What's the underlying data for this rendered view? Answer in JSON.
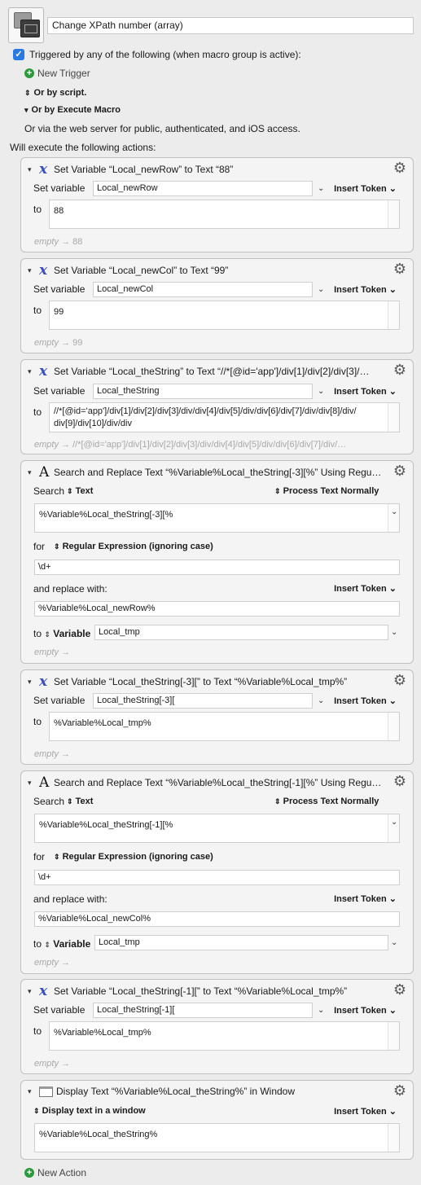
{
  "macro": {
    "name": "Change XPath number (array)"
  },
  "triggers": {
    "heading": "Triggered by any of the following (when macro group is active):",
    "new_trigger": "New Trigger",
    "or_by_script": "Or by script.",
    "or_by_execute": "Or by Execute Macro",
    "web_server": "Or via the web server for public, authenticated, and iOS access."
  },
  "will_execute": "Will execute the following actions:",
  "labels": {
    "set_variable": "Set variable",
    "to": "to",
    "insert_token": "Insert Token",
    "empty": "empty",
    "arrow": "→",
    "search": "Search",
    "text": "Text",
    "process": "Process Text Normally",
    "for": "for",
    "regex": "Regular Expression (ignoring case)",
    "replace_with": "and replace with:",
    "to_word": "to",
    "variable": "Variable",
    "display_mode": "Display text in a window"
  },
  "actions": [
    {
      "title": "Set Variable “Local_newRow” to Text “88”",
      "var": "Local_newRow",
      "value": "88",
      "preview": "88"
    },
    {
      "title": "Set Variable “Local_newCol” to Text “99”",
      "var": "Local_newCol",
      "value": "99",
      "preview": "99"
    },
    {
      "title": "Set Variable “Local_theString” to Text “//*[@id='app']/div[1]/div[2]/div[3]/…",
      "var": "Local_theString",
      "value1": "//*[@id='app']/div[1]/div[2]/div[3]/div/div[4]/div[5]/div/div[6]/div[7]/div/div[8]/div/",
      "value2": "div[9]/div[10]/div/div",
      "preview": "//*[@id='app']/div[1]/div[2]/div[3]/div/div[4]/div[5]/div/div[6]/div[7]/div/…"
    },
    {
      "title": "Search and Replace Text “%Variable%Local_theString[-3][%” Using Regu…",
      "search": "%Variable%Local_theString[-3][%",
      "pattern": "\\d+",
      "replace": "%Variable%Local_newRow%",
      "dest": "Local_tmp"
    },
    {
      "title": "Set Variable “Local_theString[-3][” to Text “%Variable%Local_tmp%”",
      "var": "Local_theString[-3][",
      "value": "%Variable%Local_tmp%"
    },
    {
      "title": "Search and Replace Text “%Variable%Local_theString[-1][%” Using Regu…",
      "search": "%Variable%Local_theString[-1][%",
      "pattern": "\\d+",
      "replace": "%Variable%Local_newCol%",
      "dest": "Local_tmp"
    },
    {
      "title": "Set Variable “Local_theString[-1][” to Text “%Variable%Local_tmp%”",
      "var": "Local_theString[-1][",
      "value": "%Variable%Local_tmp%"
    },
    {
      "title": "Display Text “%Variable%Local_theString%” in Window",
      "value": "%Variable%Local_theString%"
    }
  ],
  "new_action": "New Action"
}
